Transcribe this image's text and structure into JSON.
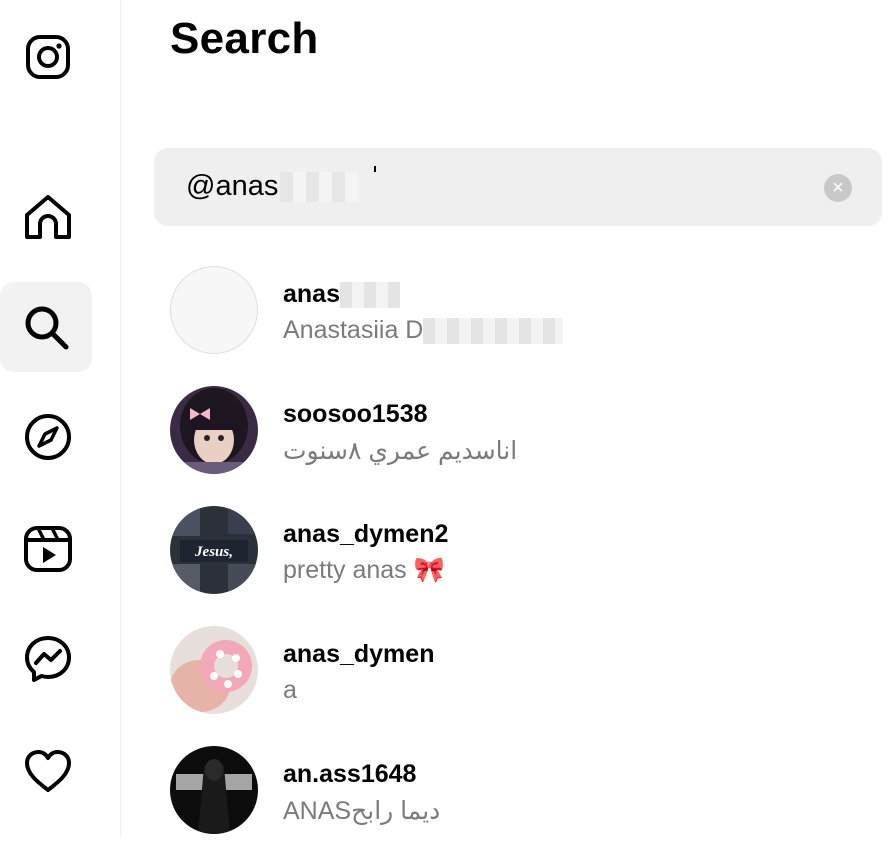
{
  "nav": {
    "items": [
      {
        "id": "home",
        "icon": "home-icon"
      },
      {
        "id": "search",
        "icon": "search-icon",
        "active": true
      },
      {
        "id": "explore",
        "icon": "compass-icon"
      },
      {
        "id": "reels",
        "icon": "reels-icon"
      },
      {
        "id": "messages",
        "icon": "messenger-icon"
      },
      {
        "id": "notifications",
        "icon": "heart-icon"
      }
    ],
    "logo_icon": "instagram-logo-icon"
  },
  "panel": {
    "title": "Search",
    "search": {
      "value": "@anas",
      "clear_icon": "clear-circle-icon"
    },
    "results": [
      {
        "username": "anas",
        "subtitle": "Anastasiia D",
        "avatar": "blank"
      },
      {
        "username": "soosoo1538",
        "subtitle": "اناسديم عمري ٨سنوت",
        "avatar": "photo-girl"
      },
      {
        "username": "anas_dymen2",
        "subtitle": "pretty anas",
        "subtitle_emoji": "🎀",
        "avatar": "photo-jesus"
      },
      {
        "username": "anas_dymen",
        "subtitle": "a",
        "avatar": "photo-pink-scrunchie"
      },
      {
        "username": "an.ass1648",
        "subtitle": "ديما رابحANAS",
        "avatar": "photo-dark-flag"
      }
    ]
  },
  "colors": {
    "search_bg": "#efefef",
    "subtitle": "#7b7b7b",
    "active_nav_bg": "#f2f2f2"
  }
}
